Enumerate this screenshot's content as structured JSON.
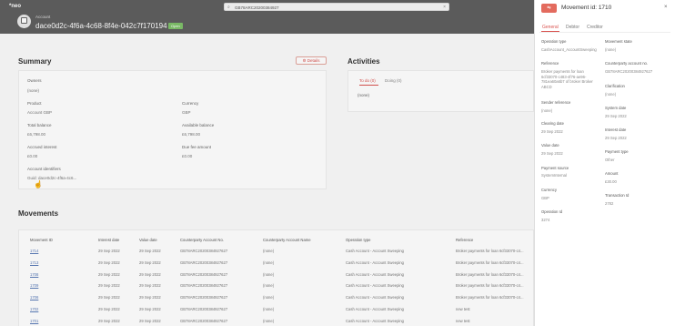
{
  "topbar": {
    "logo": "*neo",
    "search_value": "GB78ARC20200384927",
    "account_label": "Account",
    "account_id": "dace0d2c-4f6a-4c68-8f4e-042c7f170194",
    "status": "Open"
  },
  "summary": {
    "title": "Summary",
    "details_button": "Details",
    "owners_label": "Owners",
    "owners_value": "(none)",
    "product_label": "Product",
    "product_value": "Account GBP",
    "currency_label": "Currency",
    "currency_value": "GBP",
    "total_balance_label": "Total balance",
    "total_balance_value": "£6,798.00",
    "available_balance_label": "Available balance",
    "available_balance_value": "£6,798.00",
    "accrued_interest_label": "Accrued interest",
    "accrued_interest_value": "£0.00",
    "due_fee_label": "Due fee amount",
    "due_fee_value": "£0.00",
    "identifiers_label": "Account identifiers",
    "identifiers_value": "Guid: dace0d2c-4f6a-4c6..."
  },
  "activities": {
    "title": "Activities",
    "tab_todo": "To do (0)",
    "tab_doing": "Doing (0)",
    "empty": "(none)"
  },
  "movements": {
    "title": "Movements",
    "columns": [
      "Movement ID",
      "Interest date",
      "Value date",
      "Counterparty Account No.",
      "Counterparty Account Name",
      "Operation type",
      "Reference"
    ],
    "rows": [
      [
        "1714",
        "29 Sep 2022",
        "29 Sep 2022",
        "GB78ARC20200384927627",
        "(none)",
        "Cash Account - Account Sweeping",
        "Broker payments for loan 6cf33070-c4..."
      ],
      [
        "1713",
        "29 Sep 2022",
        "29 Sep 2022",
        "GB78ARC20200384927627",
        "(none)",
        "Cash Account - Account Sweeping",
        "Broker payments for loan 6cf33070-c4..."
      ],
      [
        "1708",
        "29 Sep 2022",
        "29 Sep 2022",
        "GB78ARC20200384927627",
        "(none)",
        "Cash Account - Account Sweeping",
        "Broker payments for loan 6cf33070-c4..."
      ],
      [
        "1709",
        "29 Sep 2022",
        "29 Sep 2022",
        "GB78ARC20200384927627",
        "(none)",
        "Cash Account - Account Sweeping",
        "Broker payments for loan 6cf33070-c4..."
      ],
      [
        "1706",
        "29 Sep 2022",
        "29 Sep 2022",
        "GB78ARC20200384927627",
        "(none)",
        "Cash Account - Account Sweeping",
        "Broker payments for loan 6cf33070-c4..."
      ],
      [
        "1702",
        "29 Sep 2022",
        "29 Sep 2022",
        "GB78ARC20200384927627",
        "(none)",
        "Cash Account - Account Sweeping",
        "new test"
      ],
      [
        "1701",
        "29 Sep 2022",
        "29 Sep 2022",
        "GB78ARC20200384927627",
        "(none)",
        "Cash Account - Account Sweeping",
        "new test"
      ]
    ]
  },
  "panel": {
    "title": "Movement id: 1710",
    "tabs": [
      "General",
      "Debtor",
      "Creditor"
    ],
    "operation_type_label": "Operation type",
    "operation_type_value": "CashAccount_AccountSweeping",
    "movement_state_label": "Movement state",
    "movement_state_value": "(none)",
    "reference_label": "Reference",
    "reference_lines": [
      "Broker payments for loan",
      "6cf33070-c483-4f76-ae96-",
      "781ea60a6b7 of broker Broker",
      "ABCD"
    ],
    "counterparty_label": "Counterparty account no.",
    "counterparty_value": "GB78ARC20200384927627",
    "clarification_label": "Clarification",
    "clarification_value": "(none)",
    "sender_ref_label": "Sender reference",
    "sender_ref_value": "(none)",
    "system_date_label": "System date",
    "system_date_value": "29 Sep 2022",
    "clearing_date_label": "Clearing date",
    "clearing_date_value": "29 Sep 2022",
    "interest_date_label": "Interest date",
    "interest_date_value": "29 Sep 2022",
    "value_date_label": "Value date",
    "value_date_value": "29 Sep 2022",
    "payment_type_label": "Payment type",
    "payment_type_value": "Other",
    "payment_source_label": "Payment source",
    "payment_source_value": "SystemInternal",
    "amount_label": "Amount",
    "amount_value": "£30.00",
    "currency_label": "Currency",
    "currency_value": "GBP",
    "transaction_id_label": "Transaction Id",
    "transaction_id_value": "2782",
    "operation_id_label": "Operation Id",
    "operation_id_value": "3274"
  }
}
